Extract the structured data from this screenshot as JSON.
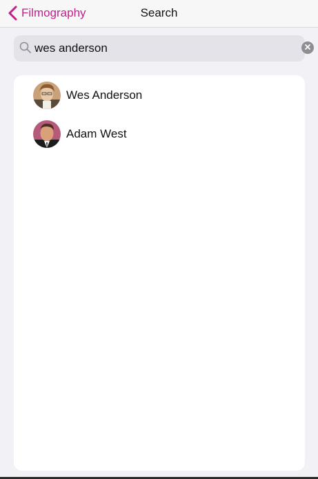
{
  "navbar": {
    "back_label": "Filmography",
    "title": "Search",
    "accent_color": "#c21e8c"
  },
  "search": {
    "value": "wes anderson",
    "placeholder": "Search",
    "icon": "search-icon",
    "clear_icon": "clear-icon"
  },
  "results": [
    {
      "name": "Wes Anderson",
      "icon": "avatar"
    },
    {
      "name": "Adam West",
      "icon": "avatar"
    }
  ]
}
